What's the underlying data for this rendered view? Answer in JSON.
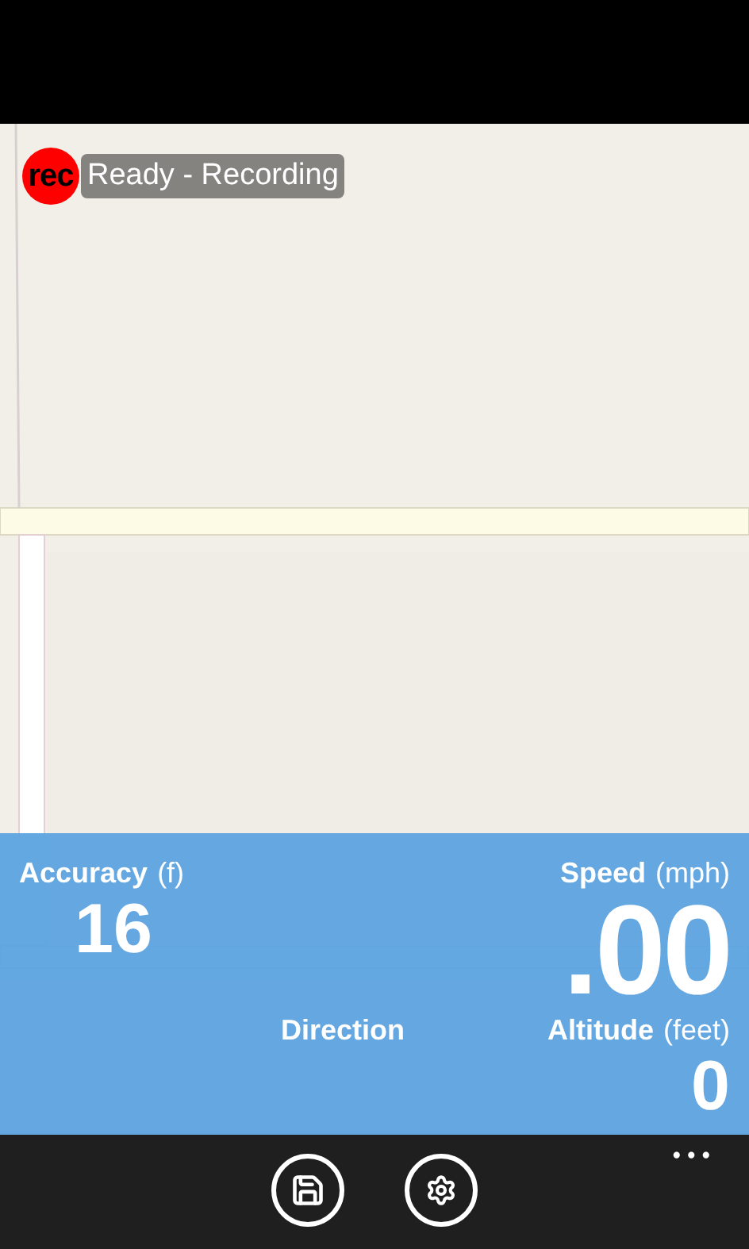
{
  "status": {
    "badge": "rec",
    "text": "Ready - Recording"
  },
  "readings": [
    {
      "kind": "accuracy",
      "label": "Accuracy",
      "unit": "(f)",
      "value": "16"
    },
    {
      "kind": "speed",
      "label": "Speed",
      "unit": "(mph)",
      "value": ".00"
    },
    {
      "kind": "direction",
      "label": "Direction"
    },
    {
      "kind": "altitude",
      "label": "Altitude",
      "unit": "(feet)",
      "value": "0"
    }
  ],
  "app_bar": {
    "buttons": [
      {
        "kind": "save"
      },
      {
        "kind": "settings"
      }
    ],
    "more": "•••"
  }
}
